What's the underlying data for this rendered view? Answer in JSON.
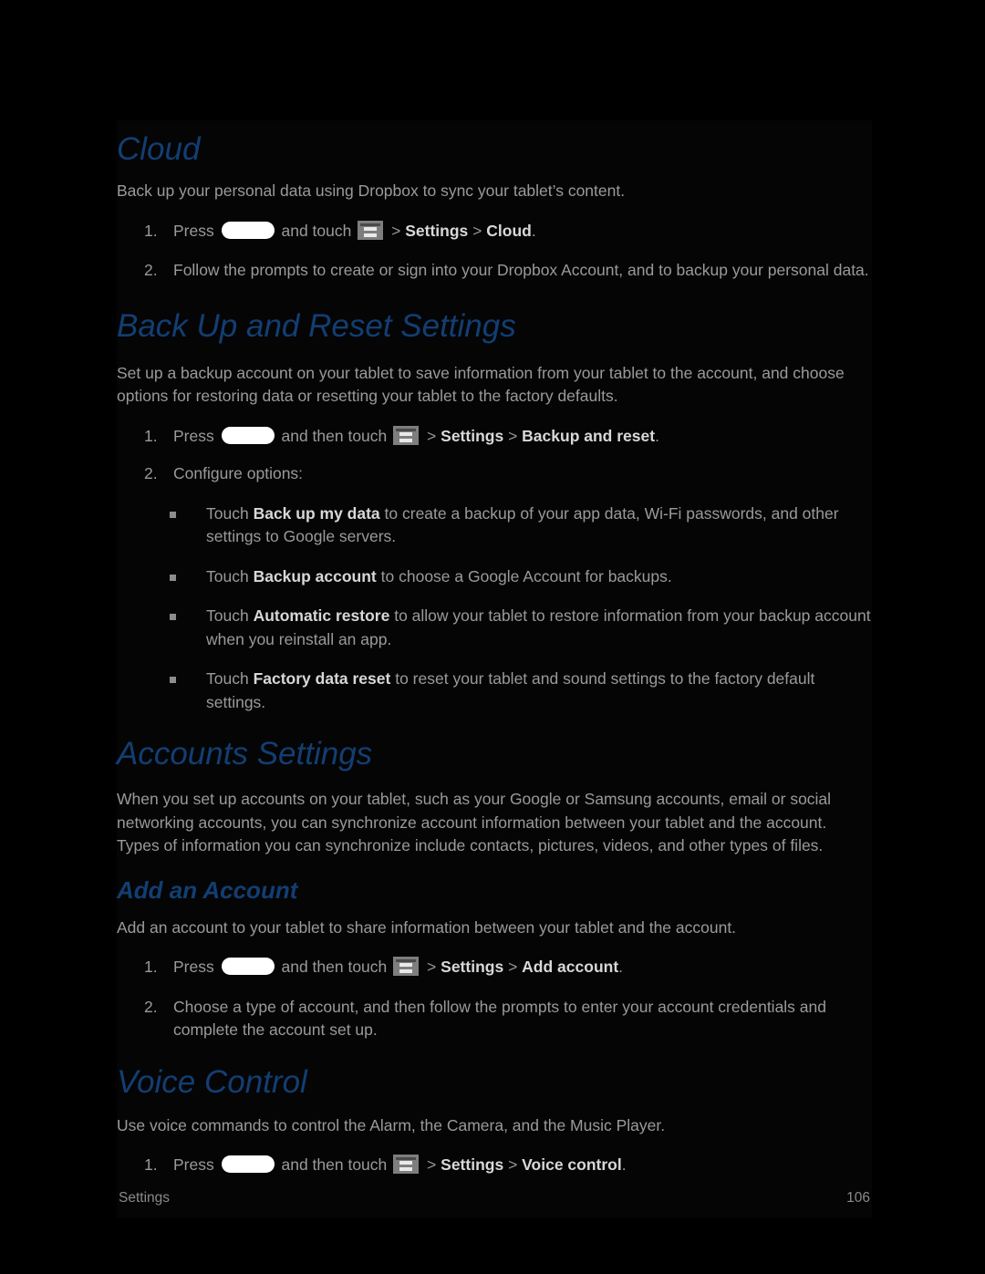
{
  "document": {
    "footer_section": "Settings",
    "page_number": "106"
  },
  "icons": {
    "home_key": "home-key-icon",
    "menu_key": "menu-key-icon",
    "bullet": "square-bullet-icon"
  },
  "colors": {
    "heading_blue": "#123E73",
    "body_gray": "#9a9a9a",
    "bold_gray": "#d8d8d8",
    "page_background": "#000000",
    "panel_background": "#050505",
    "home_key_white": "#ffffff",
    "menu_key_gray": "#7e7e7e"
  },
  "sections": {
    "cloud": {
      "heading": "Cloud",
      "intro": "Back up your personal data using Dropbox to sync your tablet’s content.",
      "steps": [
        {
          "number": "1.",
          "pre_home": "Press",
          "post_home": "and touch",
          "sep1": ">",
          "bold1": "Settings",
          "sep2": ">",
          "bold2": "Cloud",
          "end": "."
        },
        {
          "number": "2.",
          "text": "Follow the prompts to create or sign into your Dropbox Account, and to backup your personal data."
        }
      ]
    },
    "backup_reset": {
      "heading": "Back Up and Reset Settings",
      "intro": "Set up a backup account on your tablet to save information from your tablet to the account, and choose options for restoring data or resetting your tablet to the factory defaults.",
      "steps": [
        {
          "number": "1.",
          "pre_home": "Press",
          "post_home": "and then touch",
          "sep1": ">",
          "bold1": "Settings",
          "sep2": ">",
          "bold2": "Backup and reset",
          "end": "."
        },
        {
          "number": "2.",
          "text": "Configure options:"
        }
      ],
      "bullets": [
        {
          "pre": "Touch",
          "bold": "Back up my data",
          "post": "to create a backup of your app data, Wi-Fi passwords, and other settings to Google servers."
        },
        {
          "pre": "Touch",
          "bold": "Backup account",
          "post": "to choose a Google Account for backups."
        },
        {
          "pre": "Touch",
          "bold": "Automatic restore",
          "post": "to allow your tablet to restore information from your backup account when you reinstall an app."
        },
        {
          "pre": "Touch",
          "bold": "Factory data reset",
          "post": "to reset your tablet and sound settings to the factory default settings."
        }
      ]
    },
    "accounts": {
      "heading": "Accounts Settings",
      "intro": "When you set up accounts on your tablet, such as your Google or Samsung accounts, email or social networking accounts, you can synchronize account information between your tablet and the account. Types of information you can synchronize include contacts, pictures, videos, and other types of files.",
      "subheading": "Add an Account",
      "sub_intro": "Add an account to your tablet to share information between your tablet and the account.",
      "steps": [
        {
          "number": "1.",
          "pre_home": "Press",
          "post_home": "and then touch",
          "sep1": ">",
          "bold1": "Settings",
          "sep2": ">",
          "bold2": "Add account",
          "end": "."
        },
        {
          "number": "2.",
          "text": "Choose a type of account, and then follow the prompts to enter your account credentials and complete the account set up."
        }
      ]
    },
    "voice_control": {
      "heading": "Voice Control",
      "intro": "Use voice commands to control the Alarm, the Camera, and the Music Player.",
      "steps": [
        {
          "number": "1.",
          "pre_home": "Press",
          "post_home": "and then touch",
          "sep1": ">",
          "bold1": "Settings",
          "sep2": ">",
          "bold2": "Voice control",
          "end": "."
        }
      ]
    }
  }
}
